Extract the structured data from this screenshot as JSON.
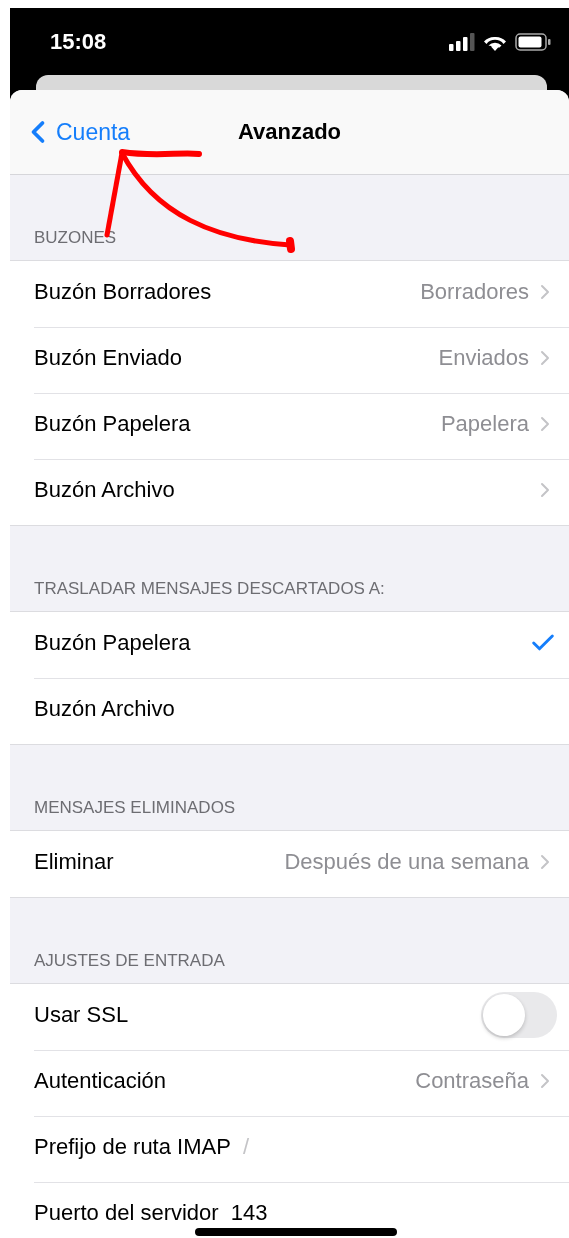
{
  "status_bar": {
    "time": "15:08"
  },
  "nav": {
    "back": "Cuenta",
    "title": "Avanzado"
  },
  "sections": [
    {
      "header": "BUZONES",
      "rows": [
        {
          "kind": "value",
          "label": "Buzón Borradores",
          "value": "Borradores"
        },
        {
          "kind": "value",
          "label": "Buzón Enviado",
          "value": "Enviados"
        },
        {
          "kind": "value",
          "label": "Buzón Papelera",
          "value": "Papelera"
        },
        {
          "kind": "value",
          "label": "Buzón Archivo"
        }
      ]
    },
    {
      "header": "TRASLADAR MENSAJES DESCARTADOS A:",
      "rows": [
        {
          "kind": "check",
          "label": "Buzón Papelera",
          "selected": true
        },
        {
          "kind": "check",
          "label": "Buzón Archivo",
          "selected": false
        }
      ]
    },
    {
      "header": "MENSAJES ELIMINADOS",
      "rows": [
        {
          "kind": "value",
          "label": "Eliminar",
          "value": "Después de una semana"
        }
      ]
    },
    {
      "header": "AJUSTES DE ENTRADA",
      "rows": [
        {
          "kind": "toggle",
          "label": "Usar SSL",
          "on": false
        },
        {
          "kind": "value",
          "label": "Autenticación",
          "value": "Contraseña"
        },
        {
          "kind": "field",
          "label": "Prefijo de ruta IMAP",
          "placeholder": "/"
        },
        {
          "kind": "field",
          "label": "Puerto del servidor",
          "value": "143"
        }
      ]
    }
  ]
}
